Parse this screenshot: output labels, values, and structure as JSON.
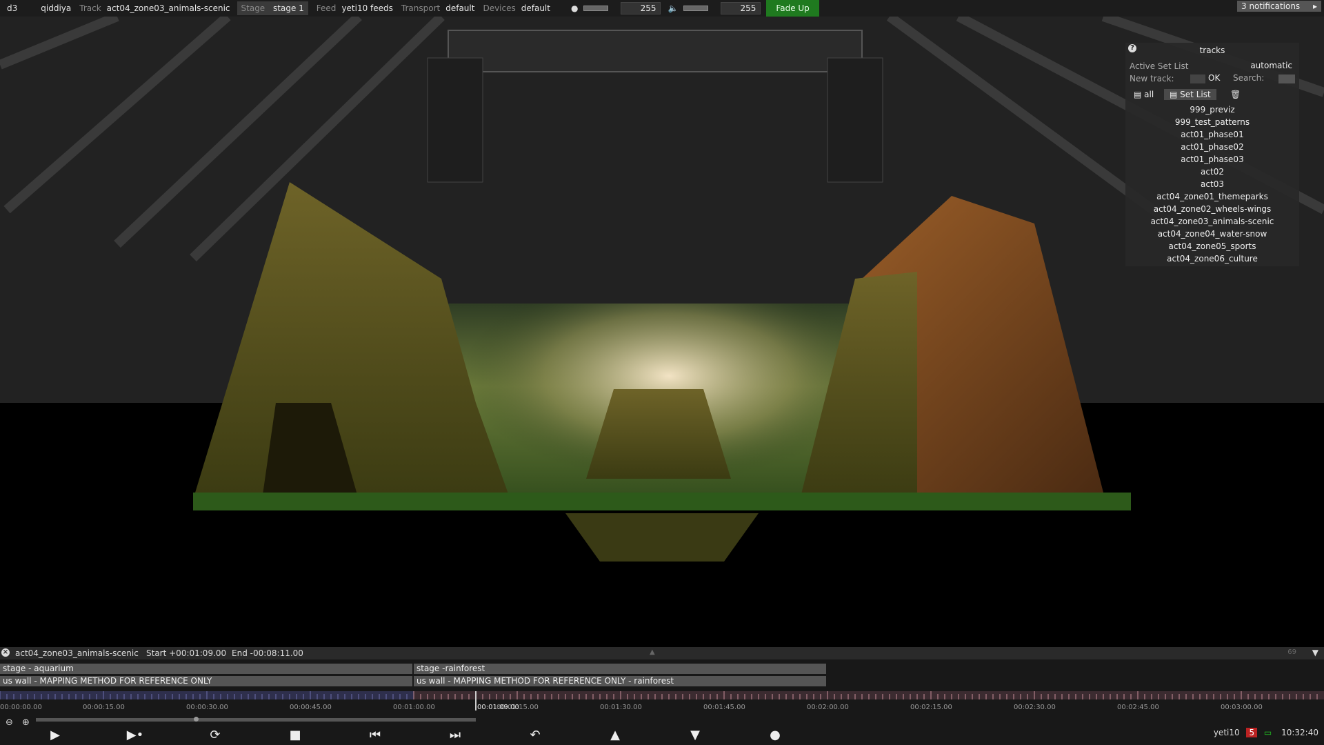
{
  "topbar": {
    "app": "d3",
    "project": "qiddiya",
    "track_label": "Track",
    "track_value": "act04_zone03_animals-scenic",
    "stage_label": "Stage",
    "stage_value": "stage 1",
    "feed_label": "Feed",
    "feed_value": "yeti10 feeds",
    "transport_label": "Transport",
    "transport_value": "default",
    "devices_label": "Devices",
    "devices_value": "default",
    "brightness_value": "255",
    "volume_value": "255",
    "fade_up_label": "Fade Up",
    "notifications": "3 notifications"
  },
  "tracks_panel": {
    "title": "tracks",
    "active_set_label": "Active Set List",
    "active_set_mode": "automatic",
    "new_track_label": "New track:",
    "ok_label": "OK",
    "search_label": "Search:",
    "filter_all": "all",
    "filter_setlist": "Set List",
    "items": [
      "999_previz",
      "999_test_patterns",
      "act01_phase01",
      "act01_phase02",
      "act01_phase03",
      "act02",
      "act03",
      "act04_zone01_themeparks",
      "act04_zone02_wheels-wings",
      "act04_zone03_animals-scenic",
      "act04_zone04_water-snow",
      "act04_zone05_sports",
      "act04_zone06_culture"
    ]
  },
  "timeline": {
    "track_name": "act04_zone03_animals-scenic",
    "start": "Start +00:01:09.00",
    "end": "End -00:08:11.00",
    "counter": "69",
    "layers": [
      {
        "name": "stage - aquarium"
      },
      {
        "name": "stage -rainforest"
      },
      {
        "name": "us wall - MAPPING METHOD FOR REFERENCE ONLY"
      },
      {
        "name": "us wall - MAPPING METHOD FOR REFERENCE ONLY - rainforest"
      }
    ],
    "ruler_labels": [
      "00:00:00.00",
      "00:00:15.00",
      "00:00:30.00",
      "00:00:45.00",
      "00:01:00.00",
      "00:01:15.00",
      "00:01:30.00",
      "00:01:45.00",
      "00:02:00.00",
      "00:02:15.00",
      "00:02:30.00",
      "00:02:45.00",
      "00:03:00.00"
    ],
    "playhead_label": "00:01:09.00",
    "section_colors": {
      "first": "#6d6fae",
      "second": "#c88f9a"
    }
  },
  "status": {
    "machine": "yeti10",
    "badge": "5",
    "clock": "10:32:40"
  },
  "transport_buttons": [
    {
      "name": "play-button",
      "icon": "play"
    },
    {
      "name": "play-to-end-button",
      "icon": "play-section"
    },
    {
      "name": "loop-button",
      "icon": "loop"
    },
    {
      "name": "stop-button",
      "icon": "stop"
    },
    {
      "name": "previous-button",
      "icon": "skip-back"
    },
    {
      "name": "next-button",
      "icon": "skip-forward"
    },
    {
      "name": "return-button",
      "icon": "return"
    },
    {
      "name": "up-button",
      "icon": "up"
    },
    {
      "name": "down-button",
      "icon": "down"
    },
    {
      "name": "record-button",
      "icon": "record"
    }
  ]
}
